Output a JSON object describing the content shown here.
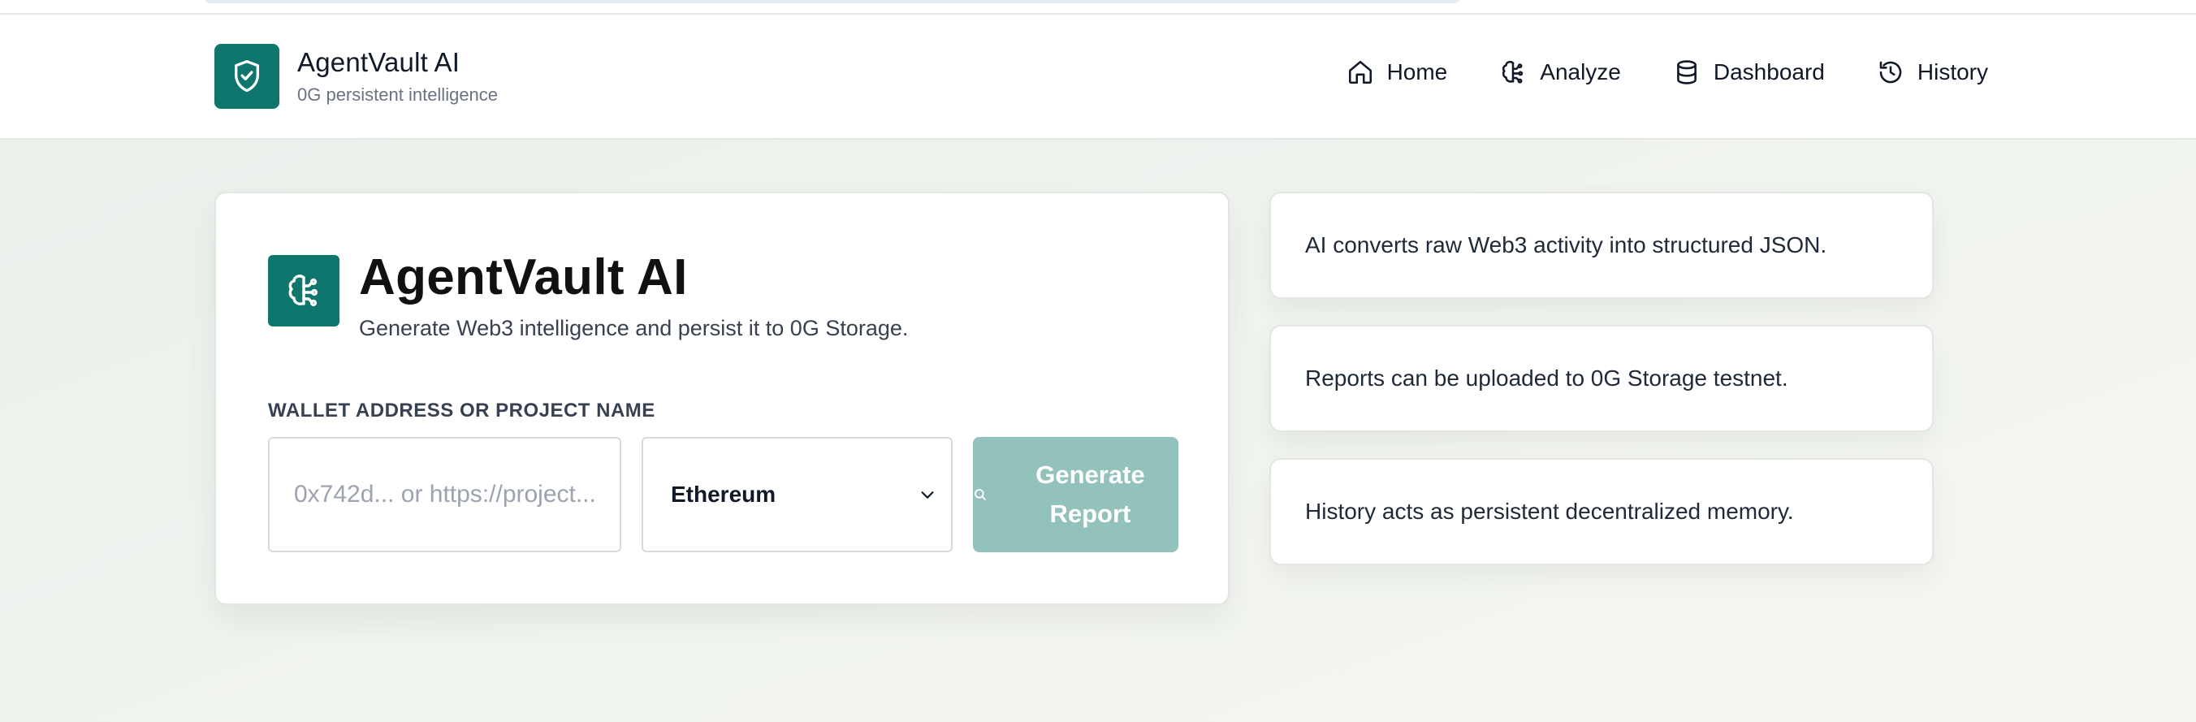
{
  "header": {
    "brand_title": "AgentVault AI",
    "brand_subtitle": "0G persistent intelligence",
    "brand_icon": "shield-check-icon",
    "nav": [
      {
        "label": "Home",
        "icon": "home-icon"
      },
      {
        "label": "Analyze",
        "icon": "brain-icon"
      },
      {
        "label": "Dashboard",
        "icon": "database-icon"
      },
      {
        "label": "History",
        "icon": "history-icon"
      }
    ]
  },
  "main": {
    "title": "AgentVault AI",
    "subtitle": "Generate Web3 intelligence and persist it to 0G Storage.",
    "title_icon": "brain-icon",
    "field_label": "WALLET ADDRESS OR PROJECT NAME",
    "input_placeholder": "0x742d... or https://project...",
    "input_value": "",
    "network_selected": "Ethereum",
    "button_label": "Generate Report",
    "button_icon": "search-icon"
  },
  "side_notes": [
    "AI converts raw Web3 activity into structured JSON.",
    "Reports can be uploaded to 0G Storage testnet.",
    "History acts as persistent decentralized memory."
  ],
  "colors": {
    "accent": "#0f766e",
    "button_disabled": "#93c2bd",
    "background": "#eef2ed"
  }
}
